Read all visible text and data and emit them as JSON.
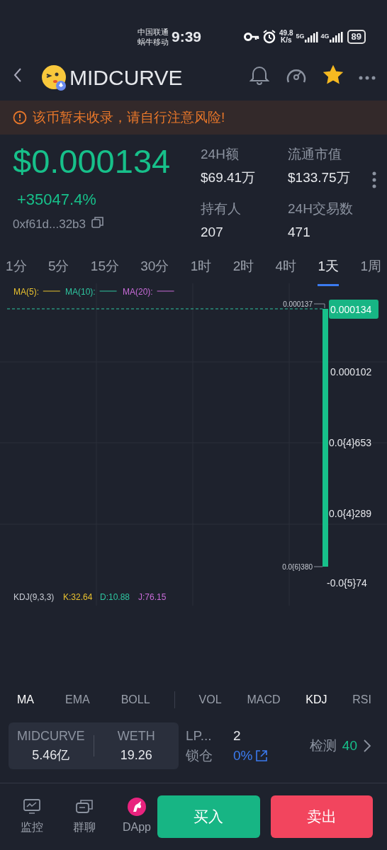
{
  "status_bar": {
    "carriers": [
      "中国联通",
      "蜗牛移动"
    ],
    "time": "9:39",
    "net_speed": [
      "49.8",
      "K/s"
    ],
    "networks": [
      "5G",
      "4G"
    ],
    "battery": "89"
  },
  "header": {
    "title": "MIDCURVE",
    "favorite": true
  },
  "warning": "该币暂未收录，请自行注意风险!",
  "price": {
    "value": "$0.000134",
    "change": "+35047.4%",
    "address": "0xf61d...32b3"
  },
  "stats": [
    {
      "label": "24H额",
      "value": "$69.41万"
    },
    {
      "label": "流通市值",
      "value": "$133.75万"
    },
    {
      "label": "持有人",
      "value": "207"
    },
    {
      "label": "24H交易数",
      "value": "471"
    }
  ],
  "timeframes": [
    {
      "label": "1分",
      "selected": false
    },
    {
      "label": "5分",
      "selected": false
    },
    {
      "label": "15分",
      "selected": false
    },
    {
      "label": "30分",
      "selected": false
    },
    {
      "label": "1时",
      "selected": false
    },
    {
      "label": "2时",
      "selected": false
    },
    {
      "label": "4时",
      "selected": false
    },
    {
      "label": "1天",
      "selected": true
    },
    {
      "label": "1周",
      "selected": false
    }
  ],
  "chart": {
    "ma_legend": [
      {
        "label": "MA(5):",
        "color": "#e8c12f"
      },
      {
        "label": "MA(10):",
        "color": "#2ec6a0"
      },
      {
        "label": "MA(20):",
        "color": "#c86bd8"
      }
    ],
    "high_label": "0.000137",
    "low_label": "0.0{6}380",
    "current_price": "0.000134",
    "axis_labels": [
      "0.000102",
      "0.0{4}653",
      "0.0{4}289",
      "-0.0{5}74"
    ],
    "kdj": {
      "title": "KDJ(9,3,3)",
      "values": [
        {
          "label": "K:32.64",
          "color": "#e8c12f"
        },
        {
          "label": "D:10.88",
          "color": "#2ec6a0"
        },
        {
          "label": "J:76.15",
          "color": "#c86bd8"
        }
      ]
    }
  },
  "indicators": {
    "main": [
      {
        "label": "MA",
        "selected": true
      },
      {
        "label": "EMA",
        "selected": false
      },
      {
        "label": "BOLL",
        "selected": false
      }
    ],
    "sub": [
      {
        "label": "VOL",
        "selected": false
      },
      {
        "label": "MACD",
        "selected": false
      },
      {
        "label": "KDJ",
        "selected": true
      },
      {
        "label": "RSI",
        "selected": false
      }
    ]
  },
  "pair": {
    "tokens": [
      {
        "symbol": "MIDCURVE",
        "amount": "5.46亿"
      },
      {
        "symbol": "WETH",
        "amount": "19.26"
      }
    ],
    "lp_label": "LP...",
    "lp_value": "2",
    "lock_label": "锁仓",
    "lock_value": "0%",
    "check_label": "检测",
    "check_score": "40"
  },
  "bottom_nav": [
    "监控",
    "群聊",
    "DApp"
  ],
  "buy": "买入",
  "sell": "卖出"
}
